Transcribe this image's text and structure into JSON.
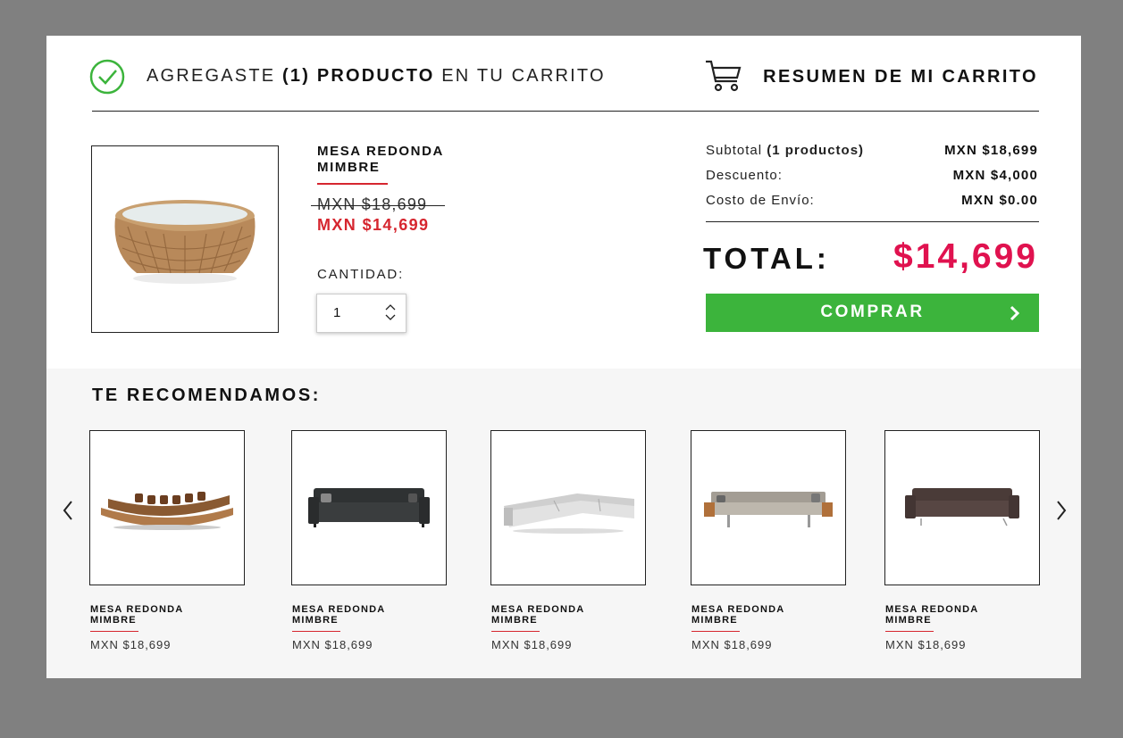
{
  "header": {
    "added_prefix": "AGREGASTE ",
    "added_count": "(1) PRODUCTO",
    "added_suffix": " EN TU CARRITO",
    "summary_title": "RESUMEN DE MI CARRITO"
  },
  "product": {
    "name": "MESA REDONDA MIMBRE",
    "old_price": "MXN $18,699",
    "new_price": "MXN $14,699",
    "quantity_label": "CANTIDAD:",
    "quantity": "1"
  },
  "summary": {
    "subtotal_label": "Subtotal ",
    "subtotal_count": "(1 productos)",
    "subtotal_value": "MXN $18,699",
    "discount_label": "Descuento:",
    "discount_value": "MXN $4,000",
    "shipping_label": "Costo de Envío:",
    "shipping_value": "MXN $0.00",
    "total_label": "TOTAL:",
    "total_value": "$14,699",
    "buy_label": "COMPRAR"
  },
  "recommendations": {
    "title": "TE RECOMENDAMOS:",
    "items": [
      {
        "name": "MESA REDONDA MIMBRE",
        "price": "MXN $18,699",
        "image": "curved-brown-sofa"
      },
      {
        "name": "MESA REDONDA MIMBRE",
        "price": "MXN $18,699",
        "image": "black-leather-sofa"
      },
      {
        "name": "MESA REDONDA MIMBRE",
        "price": "MXN $18,699",
        "image": "white-sectional-sofa"
      },
      {
        "name": "MESA REDONDA MIMBRE",
        "price": "MXN $18,699",
        "image": "beige-long-sofa"
      },
      {
        "name": "MESA REDONDA MIMBRE",
        "price": "MXN $18,699",
        "image": "dark-brown-sofa"
      }
    ]
  },
  "colors": {
    "accent_red": "#d6262f",
    "total_red": "#e0124f",
    "buy_green": "#3cb43c",
    "check_green": "#3cb43c"
  },
  "icons": [
    "check-circle-icon",
    "cart-icon",
    "chevron-up-icon",
    "chevron-down-icon",
    "chevron-right-icon",
    "chevron-left-icon"
  ]
}
